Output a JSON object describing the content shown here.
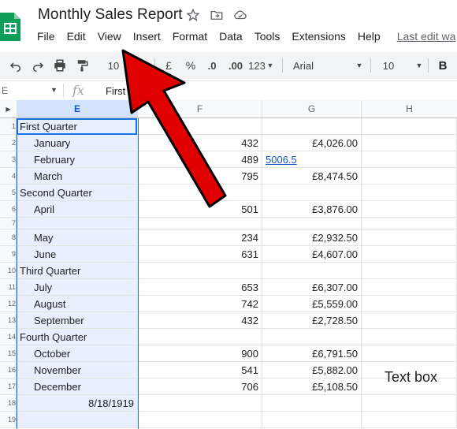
{
  "document": {
    "title": "Monthly Sales Report"
  },
  "menu": {
    "items": [
      "File",
      "Edit",
      "View",
      "Insert",
      "Format",
      "Data",
      "Tools",
      "Extensions",
      "Help"
    ],
    "last_edit": "Last edit wa"
  },
  "toolbar": {
    "zoom": "10",
    "currency": "£",
    "percent": "%",
    "decrease_decimal": ".0",
    "increase_decimal": ".00",
    "number_format": "123",
    "font_family": "Arial",
    "font_size": "10",
    "bold": "B"
  },
  "formula_bar": {
    "name_box": "E",
    "fx": "fx",
    "content": "First Quarter"
  },
  "columns": {
    "E": "E",
    "F": "F",
    "G": "G",
    "H": "H"
  },
  "rows": [
    {
      "num": "1",
      "e": "First Quarter",
      "f": "",
      "g": ""
    },
    {
      "num": "2",
      "e": "January",
      "f": "432",
      "g": "£4,026.00"
    },
    {
      "num": "3",
      "e": "February",
      "f": "489",
      "g": "5006.5"
    },
    {
      "num": "4",
      "e": "March",
      "f": "795",
      "g": "£8,474.50"
    },
    {
      "num": "5",
      "e": "Second Quarter",
      "f": "",
      "g": ""
    },
    {
      "num": "6",
      "e": "April",
      "f": "501",
      "g": "£3,876.00"
    },
    {
      "num": "7",
      "e": "",
      "f": "",
      "g": ""
    },
    {
      "num": "8",
      "e": "May",
      "f": "234",
      "g": "£2,932.50"
    },
    {
      "num": "9",
      "e": "June",
      "f": "631",
      "g": "£4,607.00"
    },
    {
      "num": "10",
      "e": "Third Quarter",
      "f": "",
      "g": ""
    },
    {
      "num": "11",
      "e": "July",
      "f": "653",
      "g": "£6,307.00"
    },
    {
      "num": "12",
      "e": "August",
      "f": "742",
      "g": "£5,559.00"
    },
    {
      "num": "13",
      "e": "September",
      "f": "432",
      "g": "£2,728.50"
    },
    {
      "num": "14",
      "e": "Fourth Quarter",
      "f": "",
      "g": ""
    },
    {
      "num": "15",
      "e": "October",
      "f": "900",
      "g": "£6,791.50"
    },
    {
      "num": "16",
      "e": "November",
      "f": "541",
      "g": "£5,882.00"
    },
    {
      "num": "17",
      "e": "December",
      "f": "706",
      "g": "£5,108.50"
    },
    {
      "num": "18",
      "e": "8/18/1919",
      "f": "",
      "g": ""
    },
    {
      "num": "19",
      "e": "",
      "f": "",
      "g": ""
    }
  ],
  "text_box": "Text box",
  "colors": {
    "selection": "#e8f0fe",
    "selection_border": "#1a73e8",
    "arrow_fill": "#e10000",
    "sheets_green": "#0f9d58"
  }
}
